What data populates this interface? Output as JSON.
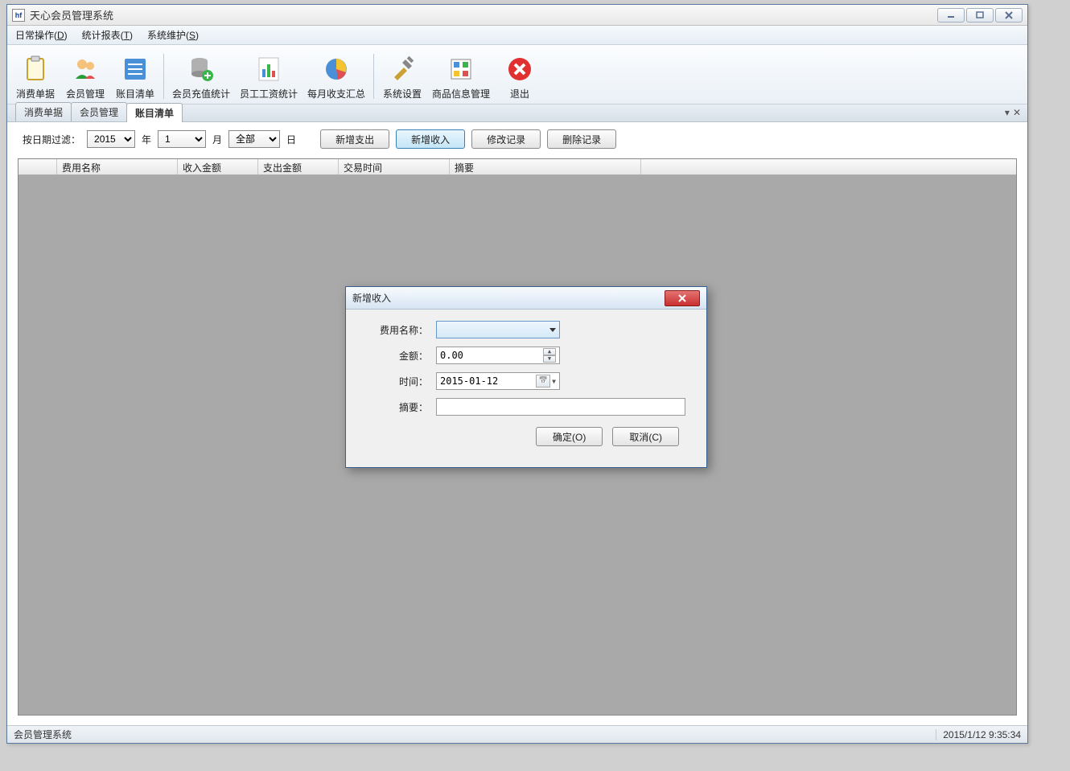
{
  "window": {
    "logo_text": "hf",
    "title": "天心会员管理系统"
  },
  "menu": {
    "item1": "日常操作(",
    "item1u": "D",
    "item1e": ")",
    "item2": "统计报表(",
    "item2u": "T",
    "item2e": ")",
    "item3": "系统维护(",
    "item3u": "S",
    "item3e": ")"
  },
  "toolbar": {
    "items": [
      {
        "label": "消费单据",
        "icon": "clipboard"
      },
      {
        "label": "会员管理",
        "icon": "users"
      },
      {
        "label": "账目清单",
        "icon": "ledger"
      },
      {
        "label": "会员充值统计",
        "icon": "db-plus"
      },
      {
        "label": "员工工资统计",
        "icon": "barchart"
      },
      {
        "label": "每月收支汇总",
        "icon": "piechart"
      },
      {
        "label": "系统设置",
        "icon": "tools"
      },
      {
        "label": "商品信息管理",
        "icon": "grid"
      },
      {
        "label": "退出",
        "icon": "exit"
      }
    ]
  },
  "tabs": {
    "t1": "消费单据",
    "t2": "会员管理",
    "t3": "账目清单"
  },
  "filter": {
    "label": "按日期过滤：",
    "year": "2015",
    "year_unit": "年",
    "month": "1",
    "month_unit": "月",
    "day": "全部",
    "day_unit": "日",
    "btn_add_expense": "新增支出",
    "btn_add_income": "新增收入",
    "btn_edit": "修改记录",
    "btn_delete": "删除记录"
  },
  "grid": {
    "headers": [
      "",
      "费用名称",
      "收入金额",
      "支出金额",
      "交易时间",
      "摘要"
    ]
  },
  "dialog": {
    "title": "新增收入",
    "row_name": "费用名称：",
    "row_amount": "金额：",
    "amount_value": "0.00",
    "row_time": "时间：",
    "time_value": "2015-01-12",
    "row_summary": "摘要：",
    "btn_ok": "确定(O)",
    "btn_cancel": "取消(C)"
  },
  "status": {
    "left": "会员管理系统",
    "right": "2015/1/12 9:35:34"
  }
}
